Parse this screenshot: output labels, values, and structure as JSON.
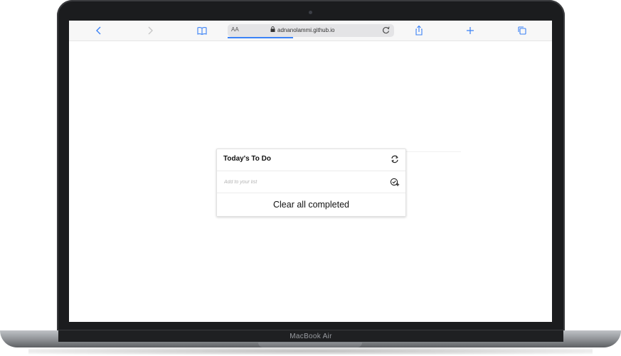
{
  "device": {
    "label": "MacBook Air"
  },
  "browser": {
    "reader_label": "AA",
    "url": "adnanolammi.github.io",
    "icons": {
      "back": "chevron-left-icon",
      "forward": "chevron-right-icon",
      "bookmarks": "book-icon",
      "lock": "lock-icon",
      "reload": "reload-icon",
      "share": "share-icon",
      "new_tab": "plus-icon",
      "tabs": "tabs-icon"
    },
    "accent": "#3b82f6"
  },
  "todo": {
    "title": "Today's To Do",
    "input_placeholder": "Add to your list",
    "input_value": "",
    "clear_label": "Clear all completed"
  }
}
